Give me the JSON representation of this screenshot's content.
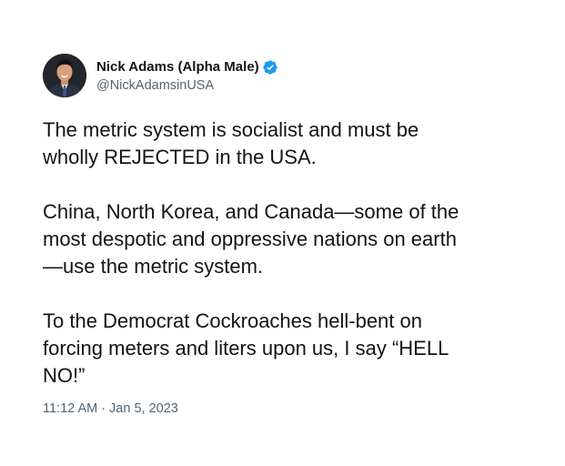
{
  "tweet": {
    "author": {
      "display_name": "Nick Adams (Alpha Male)",
      "handle": "@NickAdamsinUSA",
      "verified": true,
      "verified_color": "#1d9bf0"
    },
    "paragraphs": [
      {
        "lines": [
          "The metric system is socialist and must be",
          "wholly REJECTED in the USA."
        ]
      },
      {
        "lines": [
          "China, North Korea, and Canada—some of the",
          "most despotic and oppressive nations on earth",
          "—use the metric system."
        ]
      },
      {
        "lines": [
          "To the Democrat Cockroaches hell-bent on",
          "forcing meters and liters upon us, I say “HELL",
          "NO!”"
        ]
      }
    ],
    "time": "11:12 AM",
    "separator": "·",
    "date": "Jan 5, 2023"
  }
}
